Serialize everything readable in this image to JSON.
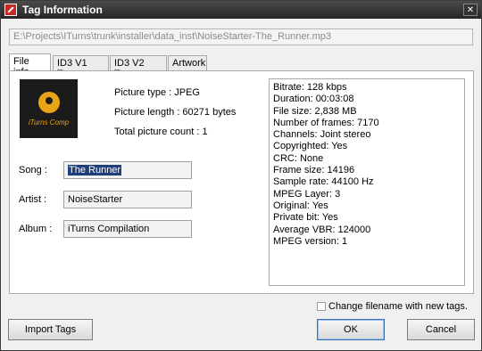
{
  "window": {
    "title": "Tag Information",
    "close_glyph": "✕"
  },
  "file_path": "E:\\Projects\\ITurns\\trunk\\installer\\data_inst\\NoiseStarter-The_Runner.mp3",
  "tabs": [
    {
      "label": "File info"
    },
    {
      "label": "ID3 V1 Tag"
    },
    {
      "label": "ID3 V2 Tag"
    },
    {
      "label": "Artwork"
    }
  ],
  "cover": {
    "text": "iTurns Comp"
  },
  "picture": {
    "type": "Picture type : JPEG",
    "length": "Picture length : 60271 bytes",
    "count": "Total picture count : 1"
  },
  "fields": {
    "song_label": "Song :",
    "song_value": "The Runner",
    "artist_label": "Artist :",
    "artist_value": "NoiseStarter",
    "album_label": "Album :",
    "album_value": "iTurns Compilation"
  },
  "info_lines": [
    "Bitrate: 128 kbps",
    "Duration: 00:03:08",
    "File size: 2,838 MB",
    "Number of frames: 7170",
    "Channels: Joint stereo",
    "Copyrighted: Yes",
    "CRC: None",
    "Frame size: 14196",
    "Sample rate: 44100 Hz",
    "MPEG Layer: 3",
    "Original: Yes",
    "Private bit: Yes",
    "Average VBR: 124000",
    "MPEG version: 1"
  ],
  "rename_checkbox": {
    "label": "Change filename with new tags.",
    "checked": false
  },
  "buttons": {
    "import": "Import Tags",
    "ok": "OK",
    "cancel": "Cancel"
  }
}
